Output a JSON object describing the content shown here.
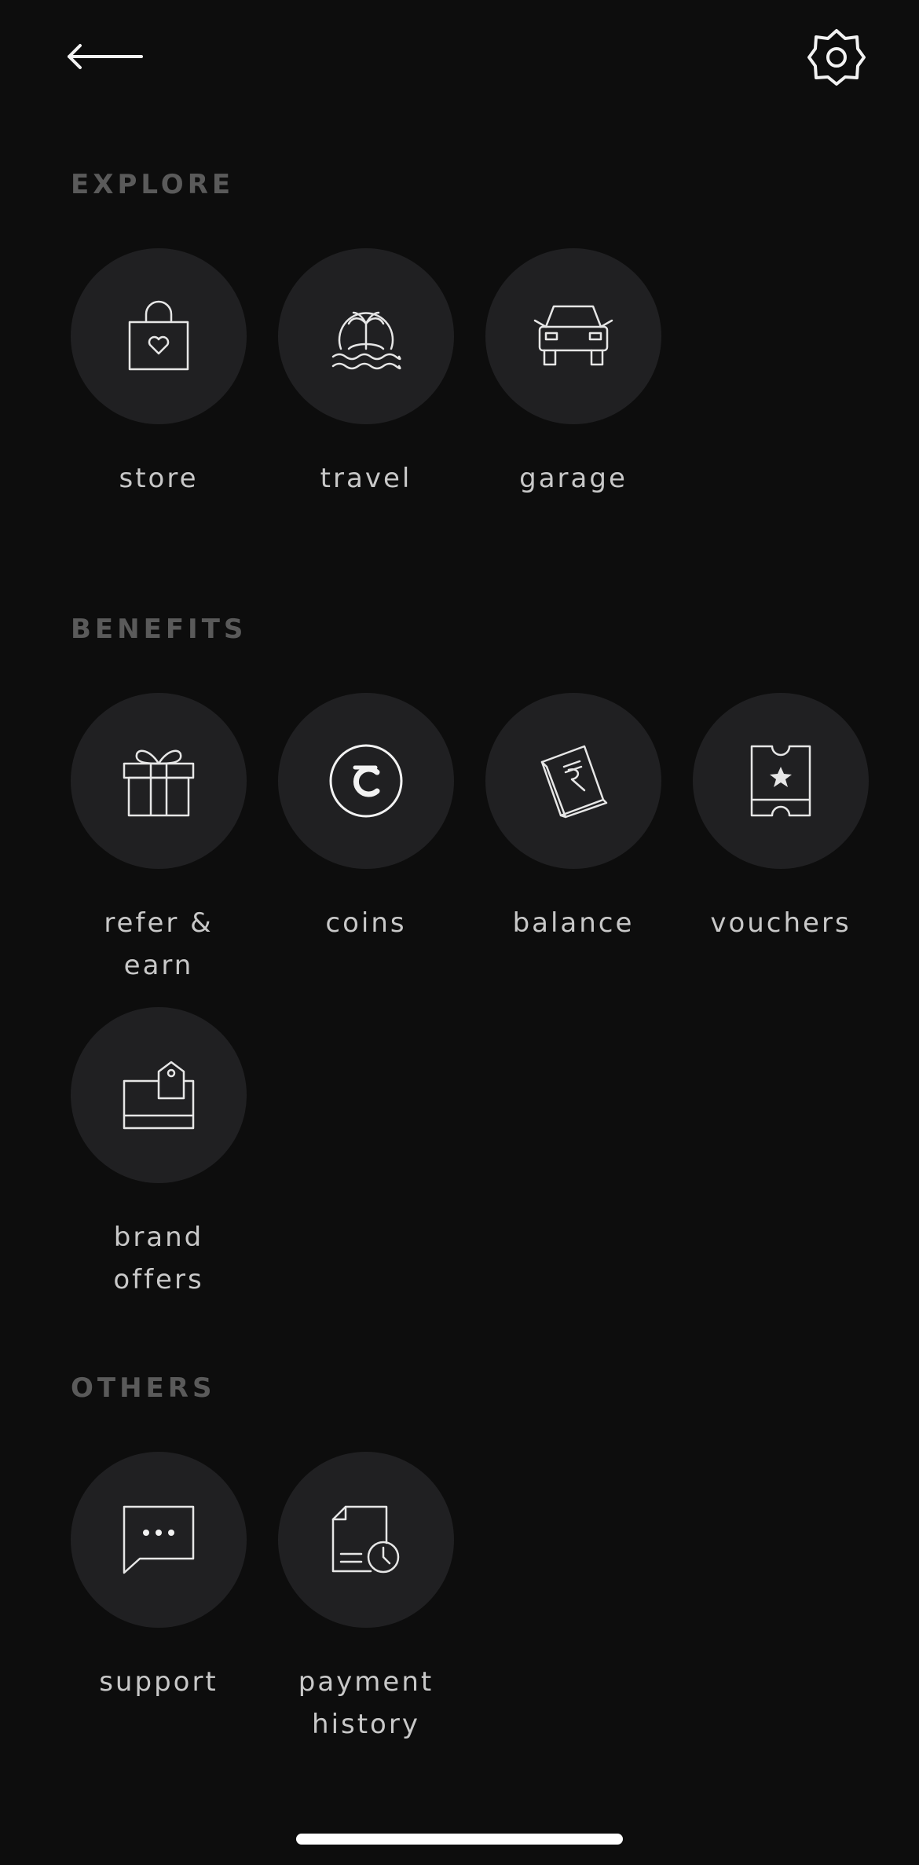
{
  "header": {
    "back_icon": "arrow-left-icon",
    "settings_icon": "gear-icon"
  },
  "sections": {
    "explore": {
      "title": "EXPLORE",
      "items": [
        {
          "label": "store",
          "icon": "shopping-bag-heart-icon"
        },
        {
          "label": "travel",
          "icon": "palm-island-icon"
        },
        {
          "label": "garage",
          "icon": "car-icon"
        }
      ]
    },
    "benefits": {
      "title": "BENEFITS",
      "items": [
        {
          "label_line1": "refer &",
          "label_line2": "earn",
          "icon": "gift-icon"
        },
        {
          "label": "coins",
          "icon": "coin-icon"
        },
        {
          "label": "balance",
          "icon": "rupee-wallet-icon"
        },
        {
          "label": "vouchers",
          "icon": "voucher-star-icon"
        },
        {
          "label_line1": "brand",
          "label_line2": "offers",
          "icon": "price-tag-offer-icon"
        }
      ]
    },
    "others": {
      "title": "OTHERS",
      "items": [
        {
          "label": "support",
          "icon": "chat-bubble-icon"
        },
        {
          "label_line1": "payment",
          "label_line2": "history",
          "icon": "receipt-clock-icon"
        }
      ]
    }
  },
  "colors": {
    "background": "#0d0d0d",
    "tile_background": "#202022",
    "section_title": "#5a5a5a",
    "label": "#c8c8c8",
    "icon_stroke": "#e6e6e6"
  }
}
